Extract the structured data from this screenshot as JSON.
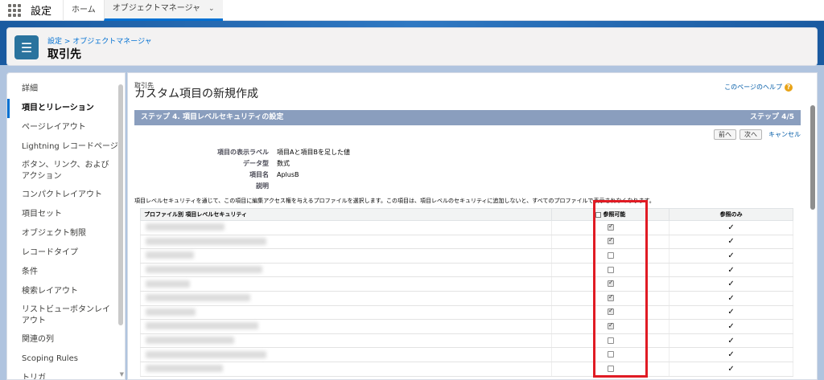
{
  "topnav": {
    "app_name": "設定",
    "tabs": [
      {
        "label": "ホーム"
      },
      {
        "label": "オブジェクトマネージャ"
      }
    ]
  },
  "header": {
    "breadcrumb": "設定 > オブジェクトマネージャ",
    "title": "取引先"
  },
  "sidebar": {
    "items": [
      {
        "label": "詳細"
      },
      {
        "label": "項目とリレーション",
        "active": true
      },
      {
        "label": "ページレイアウト"
      },
      {
        "label": "Lightning レコードページ"
      },
      {
        "label": "ボタン、リンク、およびアクション"
      },
      {
        "label": "コンパクトレイアウト"
      },
      {
        "label": "項目セット"
      },
      {
        "label": "オブジェクト制限"
      },
      {
        "label": "レコードタイプ"
      },
      {
        "label": "条件"
      },
      {
        "label": "検索レイアウト"
      },
      {
        "label": "リストビューボタンレイアウト"
      },
      {
        "label": "関連の列"
      },
      {
        "label": "Scoping Rules"
      },
      {
        "label": "トリガ"
      }
    ]
  },
  "main": {
    "object_small": "取引先",
    "title": "カスタム項目の新規作成",
    "help_link": "このページのヘルプ",
    "step_title": "ステップ 4. 項目レベルセキュリティの設定",
    "step_count": "ステップ 4/5",
    "buttons": {
      "prev": "前へ",
      "next": "次へ",
      "cancel": "キャンセル"
    },
    "fields": [
      {
        "label": "項目の表示ラベル",
        "value": "項目Aと項目Bを足した値"
      },
      {
        "label": "データ型",
        "value": "数式"
      },
      {
        "label": "項目名",
        "value": "AplusB"
      },
      {
        "label": "説明",
        "value": ""
      }
    ],
    "intro_text": "項目レベルセキュリティを通じて、この項目に編集アクセス権を与えるプロファイルを選択します。この項目は、項目レベルのセキュリティに追加しないと、すべてのプロファイルで表示されなくなります。",
    "table": {
      "headers": {
        "profile": "プロファイル別 項目レベルセキュリティ",
        "visible": "参照可能",
        "readonly": "参照のみ"
      },
      "rows": [
        {
          "visible": true,
          "readonly": true
        },
        {
          "visible": true,
          "readonly": true
        },
        {
          "visible": false,
          "readonly": true
        },
        {
          "visible": false,
          "readonly": true
        },
        {
          "visible": true,
          "readonly": true
        },
        {
          "visible": true,
          "readonly": true
        },
        {
          "visible": true,
          "readonly": true
        },
        {
          "visible": true,
          "readonly": true
        },
        {
          "visible": false,
          "readonly": true
        },
        {
          "visible": false,
          "readonly": true
        },
        {
          "visible": false,
          "readonly": true
        }
      ]
    },
    "highlight_color": "#e01b24"
  }
}
